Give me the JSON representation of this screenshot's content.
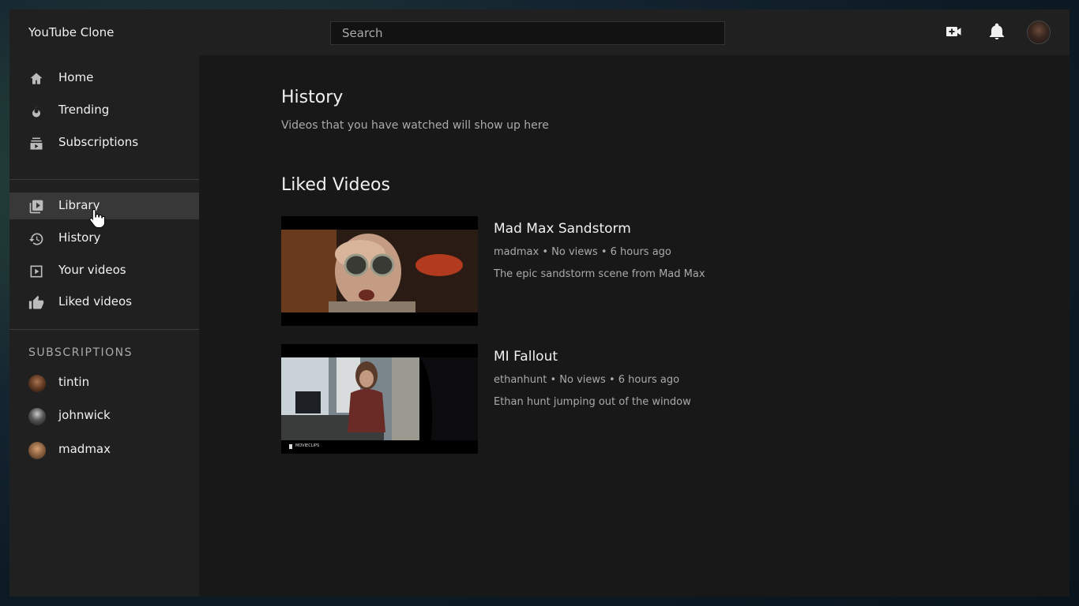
{
  "app": {
    "title": "YouTube Clone"
  },
  "search": {
    "placeholder": "Search"
  },
  "header_icons": [
    "video-camera-icon",
    "bell-icon"
  ],
  "sidebar": {
    "primary": [
      {
        "label": "Home",
        "icon": "home-icon"
      },
      {
        "label": "Trending",
        "icon": "flame-icon"
      },
      {
        "label": "Subscriptions",
        "icon": "subscriptions-icon"
      }
    ],
    "secondary": [
      {
        "label": "Library",
        "icon": "library-icon",
        "active": true
      },
      {
        "label": "History",
        "icon": "history-icon"
      },
      {
        "label": "Your videos",
        "icon": "your-videos-icon"
      },
      {
        "label": "Liked videos",
        "icon": "thumbs-up-icon"
      }
    ],
    "subscriptions_heading": "SUBSCRIPTIONS",
    "subscriptions": [
      {
        "name": "tintin"
      },
      {
        "name": "johnwick"
      },
      {
        "name": "madmax"
      }
    ]
  },
  "main": {
    "history_title": "History",
    "history_subtitle": "Videos that you have watched will show up here",
    "liked_title": "Liked Videos",
    "videos": [
      {
        "title": "Mad Max Sandstorm",
        "channel": "madmax",
        "views": "No views",
        "time": "6 hours ago",
        "description": "The epic sandstorm scene from Mad Max"
      },
      {
        "title": "MI Fallout",
        "channel": "ethanhunt",
        "views": "No views",
        "time": "6 hours ago",
        "description": "Ethan hunt jumping out of the window",
        "watermark": "MOVIECLIPS"
      }
    ]
  },
  "colors": {
    "background": "#181818",
    "surface": "#202020",
    "active": "#383838",
    "text": "#f1f1f1",
    "muted": "#aaaaaa"
  }
}
